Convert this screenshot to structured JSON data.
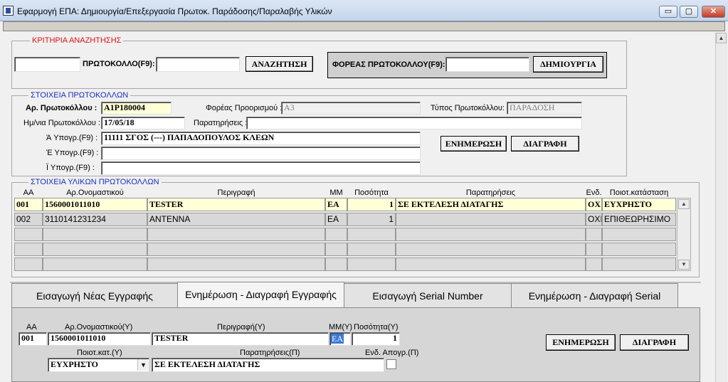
{
  "window": {
    "title": "Εφαρμογή ΕΠΑ: Δημιουργία/Επεξεργασία Πρωτοκ. Παράδοσης/Παραλαβής Υλικών",
    "min": "▭",
    "max": "▢",
    "close": "✕"
  },
  "search": {
    "legend": "ΚΡΙΤΗΡΙΑ ΑΝΑΖΗΤΗΣΗΣ",
    "field1_value": "",
    "protocol_label": "ΠΡΩΤΟΚΟΛΛΟ(F9):",
    "protocol_value": "",
    "search_button": "ΑΝΑΖΗΤΗΣΗ",
    "issuer_label": "ΦΟΡΕΑΣ ΠΡΩΤΟΚΟΛΛΟΥ(F9):",
    "issuer_value": "",
    "create_button": "ΔΗΜΙΟΥΡΓΙΑ"
  },
  "protocol": {
    "legend": "ΣΤΟΙΧΕΙΑ ΠΡΩΤΟΚΟΛΛΩΝ",
    "number_label": "Αρ. Πρωτοκόλλου :",
    "number_value": "Α1Ρ180004",
    "dest_label": "Φορέας Προορισμού :",
    "dest_value": "Α3",
    "type_label": "Τύπος Πρωτοκόλλου:",
    "type_value": "ΠΑΡΑΔΟΣΗ",
    "date_label": "Ημ/νια Πρωτοκόλλου :",
    "date_value": "17/05/18",
    "notes_label": "Παρατηρήσεις :",
    "notes_value": "",
    "sig_a_label": "Ά Υπογρ.(F9) :",
    "sig_a_value": "11111 ΣΓΟΣ (---) ΠΑΠΑΔΟΠΟΥΛΟΣ ΚΛΕΩΝ",
    "sig_b_label": "Έ Υπογρ.(F9) :",
    "sig_b_value": "",
    "sig_c_label": "Ϊ Υπογρ.(F9) :",
    "sig_c_value": "",
    "update_button": "ΕΝΗΜΕΡΩΣΗ",
    "delete_button": "ΔΙΑΓΡΑΦΗ"
  },
  "materials": {
    "legend": "ΣΤΟΙΧΕΙΑ ΥΛΙΚΩΝ ΠΡΩΤΟΚΟΛΛΩΝ",
    "headers": [
      "ΑΑ",
      "Αρ.Ονομαστικού",
      "Περιγραφή",
      "ΜΜ",
      "Ποσότητα",
      "Παρατηρήσεις",
      "Ενδ. Απογρ.",
      "Ποιοτ.κατάσταση"
    ],
    "rows": [
      [
        "001",
        "1560001011010",
        "TESTER",
        "EA",
        "1",
        "ΣΕ ΕΚΤΕΛΕΣΗ ΔΙΑΤΑΓΗΣ",
        "ΟΧ",
        "ΕΥΧΡΗΣΤΟ"
      ],
      [
        "002",
        "3110141231234",
        "ANTENNA",
        "EA",
        "1",
        "",
        "ΟΧΙ",
        "ΕΠΙΘΕΩΡΗΣΙΜΟ"
      ],
      [
        "",
        "",
        "",
        "",
        "",
        "",
        "",
        ""
      ],
      [
        "",
        "",
        "",
        "",
        "",
        "",
        "",
        ""
      ],
      [
        "",
        "",
        "",
        "",
        "",
        "",
        "",
        ""
      ]
    ]
  },
  "tabs": [
    "Εισαγωγή Νέας Εγγραφής",
    "Ενημέρωση - Διαγραφή Εγγραφής",
    "Εισαγωγή Serial Number",
    "Ενημέρωση - Διαγραφή Serial Number"
  ],
  "edit": {
    "aa_label": "ΑΑ",
    "aa_value": "001",
    "item_label": "Αρ.Ονομαστικού(Υ)",
    "item_value": "1560001011010",
    "desc_label": "Περιγραφή(Υ)",
    "desc_value": "TESTER",
    "mm_label": "ΜΜ(Υ)",
    "mm_value": "EA",
    "qty_label": "Ποσότητα(Υ)",
    "qty_value": "1",
    "quality_label": "Ποιοτ.κατ.(Υ)",
    "quality_value": "ΕΥΧΡΗΣΤΟ",
    "notes_label": "Παρατηρήσεις(Π)",
    "notes_value": "ΣΕ ΕΚΤΕΛΕΣΗ ΔΙΑΤΑΓΗΣ",
    "inv_label": "Ενδ. Απογρ.(Π)",
    "update_button": "ΕΝΗΜΕΡΩΣΗ",
    "delete_button": "ΔΙΑΓΡΑΦΗ"
  },
  "colors": {
    "titlebar": "#c3d5ec",
    "legend_red": "#e01010",
    "legend_blue": "#1a2ec0",
    "selected_row": "#ffffd8",
    "tab_panel": "#d6d6d6"
  }
}
